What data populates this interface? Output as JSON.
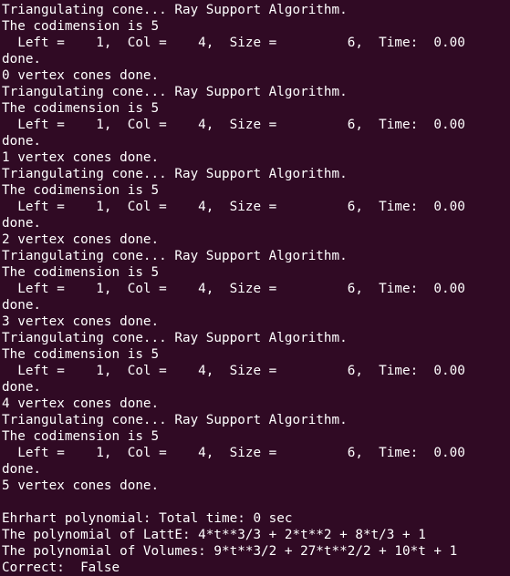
{
  "colors": {
    "background": "#300a24",
    "foreground": "#ffffff"
  },
  "terminal": {
    "lines": [
      "Triangulating cone... Ray Support Algorithm.",
      "The codimension is 5",
      "  Left =    1,  Col =    4,  Size =         6,  Time:  0.00",
      "done.",
      "0 vertex cones done.",
      "Triangulating cone... Ray Support Algorithm.",
      "The codimension is 5",
      "  Left =    1,  Col =    4,  Size =         6,  Time:  0.00",
      "done.",
      "1 vertex cones done.",
      "Triangulating cone... Ray Support Algorithm.",
      "The codimension is 5",
      "  Left =    1,  Col =    4,  Size =         6,  Time:  0.00",
      "done.",
      "2 vertex cones done.",
      "Triangulating cone... Ray Support Algorithm.",
      "The codimension is 5",
      "  Left =    1,  Col =    4,  Size =         6,  Time:  0.00",
      "done.",
      "3 vertex cones done.",
      "Triangulating cone... Ray Support Algorithm.",
      "The codimension is 5",
      "  Left =    1,  Col =    4,  Size =         6,  Time:  0.00",
      "done.",
      "4 vertex cones done.",
      "Triangulating cone... Ray Support Algorithm.",
      "The codimension is 5",
      "  Left =    1,  Col =    4,  Size =         6,  Time:  0.00",
      "done.",
      "5 vertex cones done.",
      "",
      "Ehrhart polynomial: Total time: 0 sec",
      "The polynomial of LattE: 4*t**3/3 + 2*t**2 + 8*t/3 + 1",
      "The polynomial of Volumes: 9*t**3/2 + 27*t**2/2 + 10*t + 1",
      "Correct:  False"
    ]
  }
}
